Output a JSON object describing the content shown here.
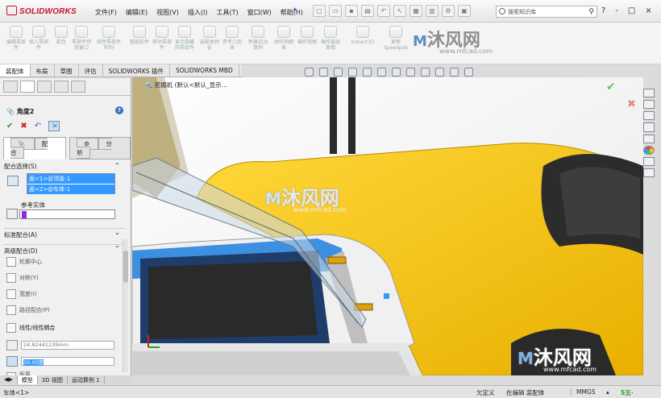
{
  "app": {
    "logo": "SOLIDWORKS"
  },
  "menu": [
    "文件(F)",
    "编辑(E)",
    "视图(V)",
    "插入(I)",
    "工具(T)",
    "窗口(W)",
    "帮助(H)"
  ],
  "search": {
    "placeholder": "搜索知识库"
  },
  "window_controls": [
    "?",
    "-",
    "□",
    "×"
  ],
  "ribbon": [
    {
      "label": "编辑零部件"
    },
    {
      "label": "插入零部件"
    },
    {
      "label": "配合"
    },
    {
      "label": "零部件预览窗口"
    },
    {
      "label": "线性零部件阵列"
    },
    {
      "label": "智能扣件"
    },
    {
      "label": "移动零部件"
    },
    {
      "label": "显示隐藏的零部件"
    },
    {
      "label": "装配体特征"
    },
    {
      "label": "参考几何体"
    },
    {
      "label": "新建运动算例"
    },
    {
      "label": "材料明细表"
    },
    {
      "label": "爆炸视图"
    },
    {
      "label": "爆炸直线草图"
    },
    {
      "label": "Instant3D"
    },
    {
      "label": "更新Speedpak"
    }
  ],
  "watermark": {
    "brand": "沐风网",
    "url": "www.mfcad.com"
  },
  "cmd_tabs": [
    "装配体",
    "布局",
    "草图",
    "评估",
    "SOLIDWORKS 插件",
    "SOLIDWORKS MBD"
  ],
  "panel": {
    "title": "角度2",
    "subtabs": [
      "配合",
      "分析"
    ],
    "mate_selection_header": "配合选择(S)",
    "selections": [
      "面<1>@顶盖-1",
      "面<2>@车体-1"
    ],
    "reference_label": "参考实体",
    "standard_header": "标准配合(A)",
    "advanced_header": "高级配合(D)",
    "advanced_options": [
      "轮廓中心",
      "对称(Y)",
      "宽度(I)",
      "路径配合(P)",
      "线性/线性耦合"
    ],
    "distance_value": "24.82441239mm",
    "angle_value": "30.00度",
    "last_option": "距离"
  },
  "bottom_tabs": [
    "模型",
    "3D 视图",
    "运动算例 1"
  ],
  "viewport": {
    "tree_label": "挖掘机 (默认<默认_显示..."
  },
  "status": {
    "left": "车体<1>",
    "underdefined": "欠定义",
    "editing": "在编辑 装配体",
    "units": "MMGS"
  },
  "colors": {
    "yellow": "#f5c21a",
    "blue": "#3d8fe0",
    "select": "#3399ff",
    "logo_red": "#c8102e"
  }
}
